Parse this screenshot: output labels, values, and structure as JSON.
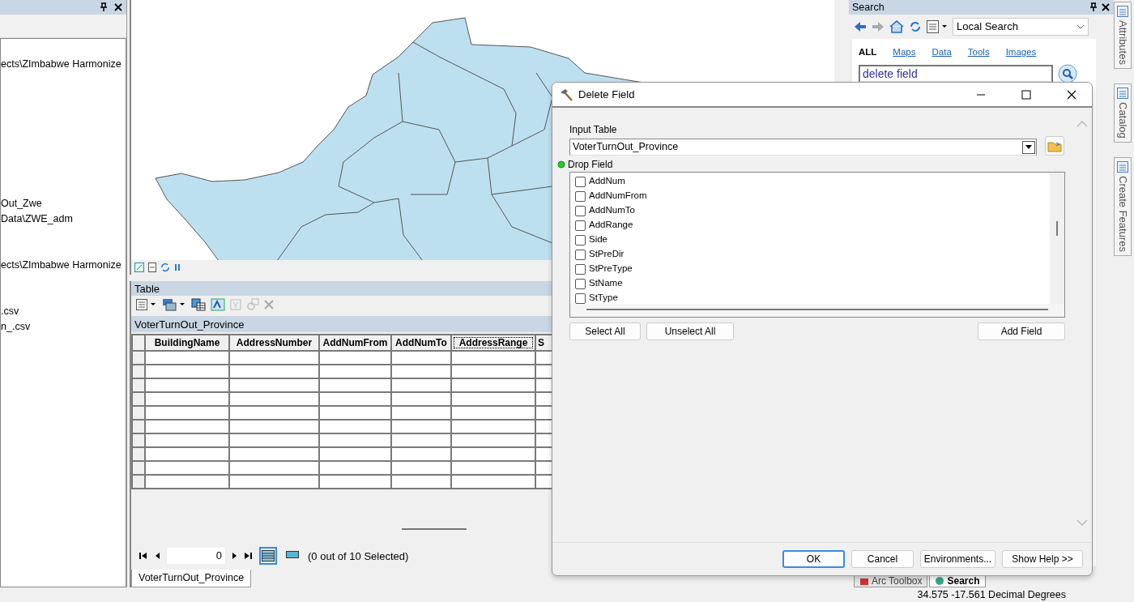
{
  "toc_panel": {
    "items": [
      {
        "label": "ects\\ZImbabwe Harmonize"
      },
      {
        "label": "Out_Zwe"
      },
      {
        "label": "Data\\ZWE_adm"
      },
      {
        "label": "ects\\ZImbabwe Harmonize"
      },
      {
        "label": ".csv"
      },
      {
        "label": "n_.csv"
      }
    ]
  },
  "table_window": {
    "title": "Table",
    "table_name": "VoterTurnOut_Province",
    "columns": [
      {
        "label": "BuildingName",
        "selected": false
      },
      {
        "label": "AddressNumber",
        "selected": false
      },
      {
        "label": "AddNumFrom",
        "selected": false
      },
      {
        "label": "AddNumTo",
        "selected": false
      },
      {
        "label": "AddressRange",
        "selected": true
      },
      {
        "label": "S",
        "selected": false
      }
    ],
    "rows": [
      {
        "selected": false
      },
      {
        "selected": false
      },
      {
        "selected": false
      },
      {
        "selected": false
      },
      {
        "selected": false
      },
      {
        "selected": false
      },
      {
        "selected": false
      },
      {
        "selected": false
      },
      {
        "selected": false
      },
      {
        "selected": false
      }
    ],
    "record": "0",
    "selection_text": "(0 out of 10 Selected)",
    "views": [
      {
        "kind": "all",
        "selected": true
      },
      {
        "kind": "selected",
        "selected": false
      }
    ],
    "tab": "VoterTurnOut_Province"
  },
  "search_panel": {
    "title": "Search",
    "scope": "Local Search",
    "tabs": [
      {
        "label": "ALL",
        "selected": true
      },
      {
        "label": "Maps",
        "selected": false
      },
      {
        "label": "Data",
        "selected": false
      },
      {
        "label": "Tools",
        "selected": false
      },
      {
        "label": "Images",
        "selected": false
      }
    ],
    "query": "delete field"
  },
  "bottom_tabs": [
    {
      "label": "Arc Toolbox",
      "selected": false
    },
    {
      "label": "Search",
      "selected": true
    }
  ],
  "side_tabs": [
    {
      "label": "Attributes"
    },
    {
      "label": "Catalog"
    },
    {
      "label": "Create Features"
    }
  ],
  "status_bar": {
    "coordinates": "34.575  -17.561 Decimal Degrees"
  },
  "dialog": {
    "title": "Delete Field",
    "input_table_label": "Input Table",
    "input_table": "VoterTurnOut_Province",
    "drop_field_label": "Drop Field",
    "fields": [
      {
        "label": "AddNum",
        "checked": false
      },
      {
        "label": "AddNumFrom",
        "checked": false
      },
      {
        "label": "AddNumTo",
        "checked": false
      },
      {
        "label": "AddRange",
        "checked": false
      },
      {
        "label": "Side",
        "checked": false
      },
      {
        "label": "StPreDir",
        "checked": false
      },
      {
        "label": "StPreType",
        "checked": false
      },
      {
        "label": "StName",
        "checked": false
      },
      {
        "label": "StType",
        "checked": false
      }
    ],
    "list_buttons": [
      "Select All",
      "Unselect All"
    ],
    "add_button": "Add Field",
    "footer_buttons": [
      {
        "label": "OK",
        "default": true
      },
      {
        "label": "Cancel",
        "default": false
      },
      {
        "label": "Environments...",
        "default": false
      },
      {
        "label": "Show Help >>",
        "default": false
      }
    ]
  }
}
